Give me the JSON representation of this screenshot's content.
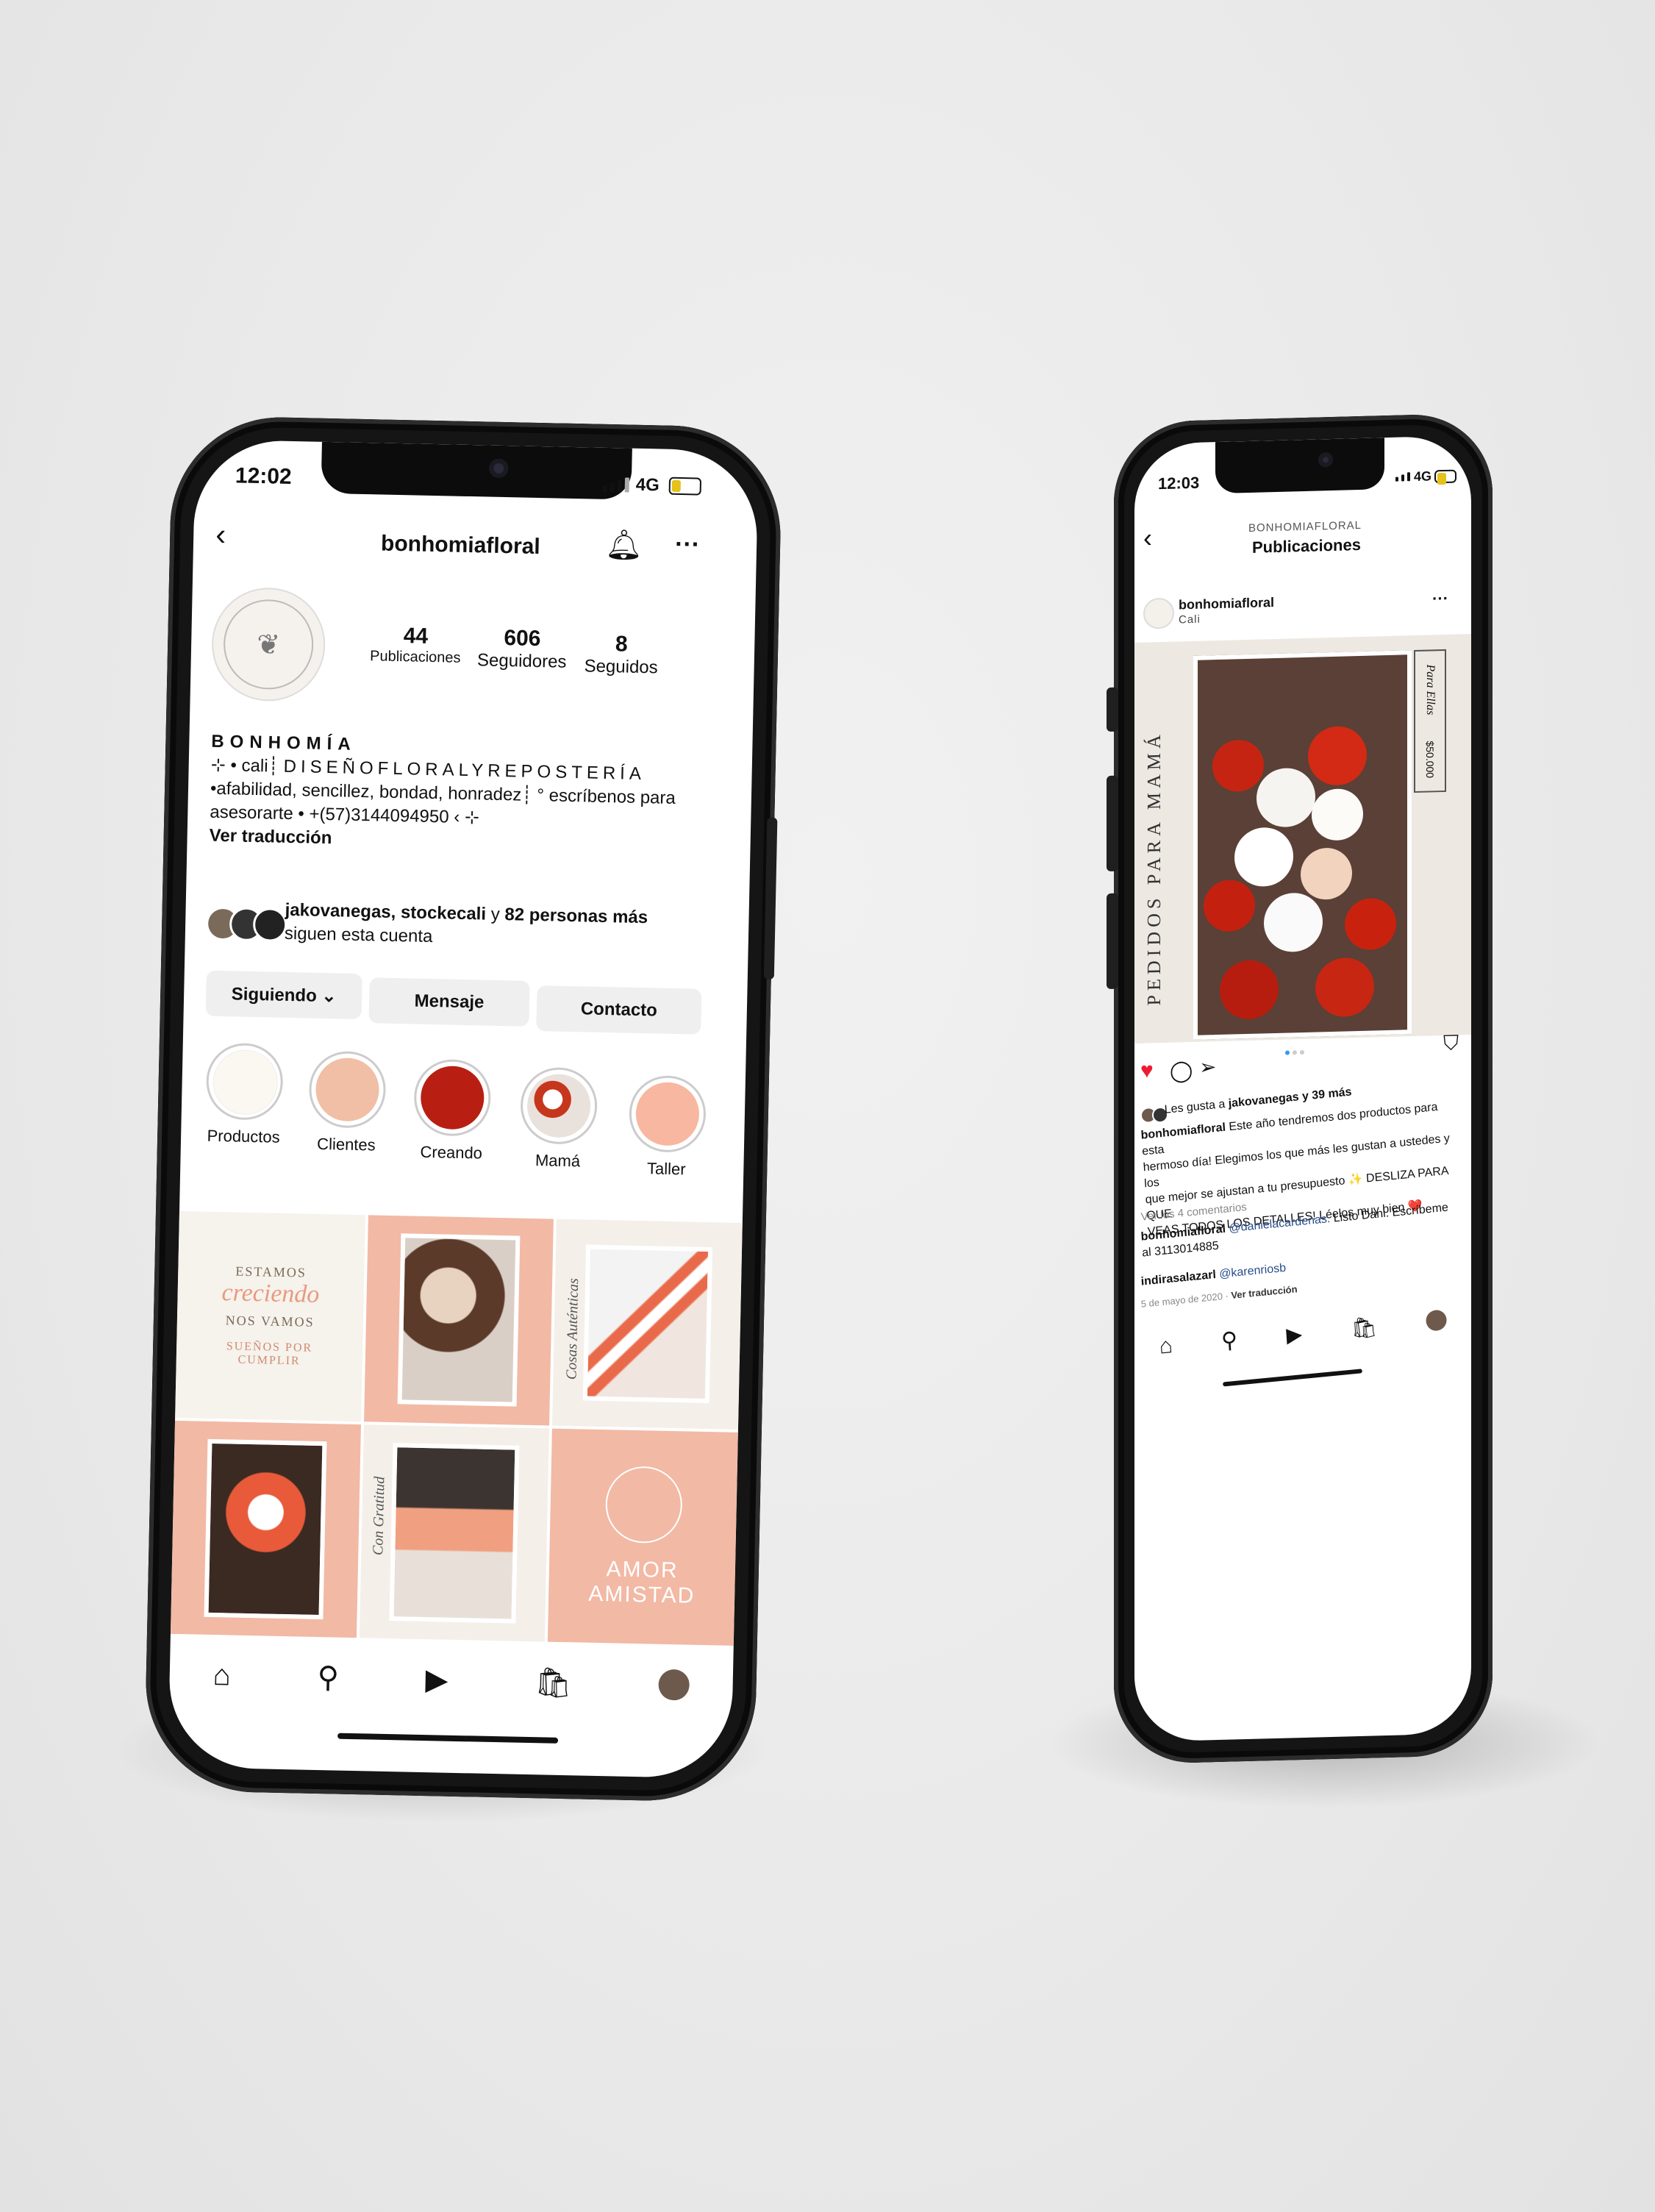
{
  "left_phone": {
    "status": {
      "time": "12:02",
      "network": "4G"
    },
    "header": {
      "username": "bonhomiafloral"
    },
    "stats": [
      {
        "value": "44",
        "label": "Publicaciones"
      },
      {
        "value": "606",
        "label": "Seguidores"
      },
      {
        "value": "8",
        "label": "Seguidos"
      }
    ],
    "bio": {
      "name": "BONHOMÍA",
      "line1_prefix": "⊹ • cali┊",
      "line1_spaced": "DISEÑOFLORALYREPOSTERÍA",
      "line2": "•afabilidad, sencillez, bondad, honradez┊ ° escríbenos para",
      "line3": "asesorarte • +(57)3144094950 ‹ ⊹",
      "translate": "Ver traducción"
    },
    "followers": {
      "names": "jakovanegas, stockecali",
      "and": "y",
      "more": "82 personas más",
      "suffix": "siguen esta cuenta"
    },
    "actions": {
      "following": "Siguiendo ⌄",
      "message": "Mensaje",
      "contact": "Contacto"
    },
    "highlights": [
      {
        "label": "Productos",
        "color": "#fbf8f2"
      },
      {
        "label": "Clientes",
        "color": "#f0bfa6"
      },
      {
        "label": "Creando",
        "color": "#b81f12"
      },
      {
        "label": "Mamá",
        "color": "#e9e2dc"
      },
      {
        "label": "Taller",
        "color": "#f7b7a0"
      }
    ],
    "grid": {
      "cell1": {
        "line1": "ESTAMOS",
        "line2": "creciendo",
        "line3": "NOS VAMOS",
        "line4": "SUEÑOS POR",
        "line5": "CUMPLIR"
      },
      "cell3": {
        "script": "Cosas Auténticas"
      },
      "cell5": {
        "script": "Con Gratitud"
      },
      "cell6": {
        "line1": "AMOR",
        "line2": "AMISTAD"
      }
    }
  },
  "right_phone": {
    "status": {
      "time": "12:03",
      "network": "4G"
    },
    "header": {
      "small": "BONHOMIAFLORAL",
      "title": "Publicaciones"
    },
    "post": {
      "user": "bonhomiafloral",
      "location": "Cali",
      "vertical_title": "PEDIDOS PARA MAMÁ",
      "tag_script": "Para Ellas",
      "price": "$50.000"
    },
    "likes": {
      "text": "Les gusta a",
      "user": "jakovanegas",
      "rest": "y 39 más"
    },
    "caption": {
      "user": "bonhomiafloral",
      "line1": "Este año tendremos dos productos para esta",
      "line2": "hermoso día! Elegimos los que más les gustan a ustedes y los",
      "line3": "que mejor se ajustan a tu presupuesto ✨ DESLIZA PARA QUE",
      "line4": "VEAS TODOS LOS DETALLES! Léelos muy bien ❤️"
    },
    "comments_link": "Ver los 4 comentarios",
    "comment1": {
      "user": "bonhomiafloral",
      "mention": "@danielacardenas.",
      "text": "Listo Dani. Escríbeme",
      "line2": "al 3113014885"
    },
    "comment2": {
      "user": "indirasalazarl",
      "mention": "@karenriosb"
    },
    "date": "5 de mayo de 2020",
    "date_translate": "Ver traducción"
  }
}
